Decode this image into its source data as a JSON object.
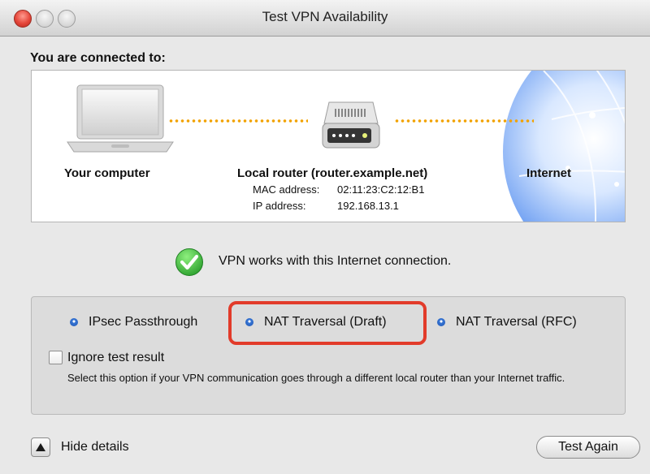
{
  "window": {
    "title": "Test VPN Availability"
  },
  "connection": {
    "heading": "You are connected to:",
    "nodes": {
      "computer": "Your computer",
      "router": "Local router (router.example.net)",
      "internet": "Internet"
    },
    "router_details": {
      "mac_label": "MAC address:",
      "mac_value": "02:11:23:C2:12:B1",
      "ip_label": "IP address:",
      "ip_value": "192.168.13.1"
    }
  },
  "status": {
    "text": "VPN works with this Internet connection.",
    "icon": "checkmark-icon",
    "color": "#3cb83a"
  },
  "options": [
    {
      "label": "IPsec Passthrough"
    },
    {
      "label": "NAT Traversal (Draft)",
      "highlighted": true
    },
    {
      "label": "NAT Traversal (RFC)"
    }
  ],
  "ignore": {
    "label": "Ignore test result",
    "checked": false,
    "help": "Select this option if your VPN communication goes through a different local router than your Internet traffic."
  },
  "footer": {
    "details_label": "Hide details",
    "button_label": "Test Again"
  },
  "colors": {
    "highlight": "#e23b2a",
    "dots": "#f2a200",
    "globe": "#2f6ee0"
  }
}
